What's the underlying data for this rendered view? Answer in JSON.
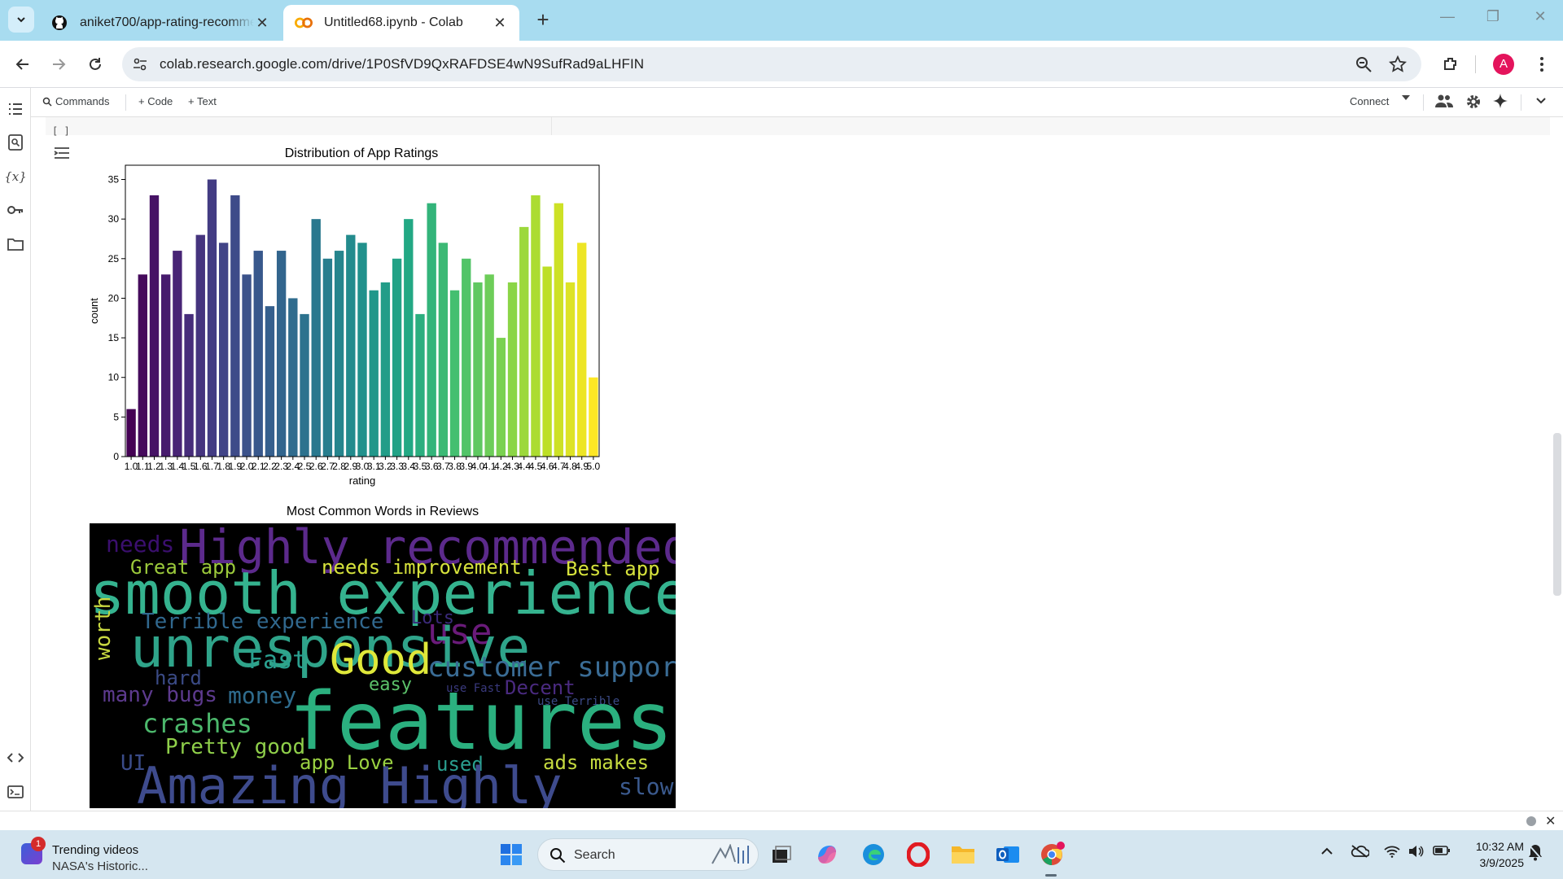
{
  "browser": {
    "tabs": [
      {
        "title": "aniket700/app-rating-recomme",
        "favicon": "github-icon",
        "active": false
      },
      {
        "title": "Untitled68.ipynb - Colab",
        "favicon": "colab-icon",
        "active": true
      }
    ],
    "new_tab": "+",
    "url": "colab.research.google.com/drive/1P0SfVD9QxRAFDSE4wN9SufRad9aLHFIN",
    "profile_initial": "A"
  },
  "colab": {
    "toolbar": {
      "commands": "Commands",
      "code": "+ Code",
      "text": "+ Text",
      "connect": "Connect"
    },
    "cell_run": "[ ]"
  },
  "chart_data": [
    {
      "type": "bar",
      "title": "Distribution of App Ratings",
      "xlabel": "rating",
      "ylabel": "count",
      "categories": [
        "1.0",
        "1.1",
        "1.2",
        "1.3",
        "1.4",
        "1.5",
        "1.6",
        "1.7",
        "1.8",
        "1.9",
        "2.0",
        "2.1",
        "2.2",
        "2.3",
        "2.4",
        "2.5",
        "2.6",
        "2.7",
        "2.8",
        "2.9",
        "3.0",
        "3.1",
        "3.2",
        "3.3",
        "3.4",
        "3.5",
        "3.6",
        "3.7",
        "3.8",
        "3.9",
        "4.0",
        "4.1",
        "4.2",
        "4.3",
        "4.4",
        "4.5",
        "4.6",
        "4.7",
        "4.8",
        "4.9",
        "5.0"
      ],
      "values": [
        6,
        23,
        33,
        23,
        26,
        18,
        28,
        35,
        27,
        33,
        23,
        26,
        19,
        26,
        20,
        18,
        30,
        25,
        26,
        28,
        27,
        21,
        22,
        25,
        30,
        18,
        32,
        27,
        21,
        25,
        22,
        23,
        15,
        22,
        29,
        33,
        24,
        32,
        22,
        27,
        10
      ],
      "yticks": [
        0,
        5,
        10,
        15,
        20,
        25,
        30,
        35
      ],
      "ylim": [
        0,
        36.8
      ],
      "palette": "viridis",
      "grid": false,
      "legend": "none"
    },
    {
      "type": "wordcloud",
      "title": "Most Common Words in Reviews",
      "words": [
        {
          "text": "needs",
          "color": "#3b0f6f"
        },
        {
          "text": "Highly recommended",
          "color": "#5c2a8c"
        },
        {
          "text": "Great app",
          "color": "#9bc93b"
        },
        {
          "text": "needs improvement",
          "color": "#d6e23c"
        },
        {
          "text": "Best app",
          "color": "#d6e23c"
        },
        {
          "text": "smooth experience",
          "color": "#35b38f"
        },
        {
          "text": "worth",
          "color": "#c9d941"
        },
        {
          "text": "Terrible experience",
          "color": "#31688e"
        },
        {
          "text": "Lots",
          "color": "#3b2a7a"
        },
        {
          "text": "use",
          "color": "#6a1b7a"
        },
        {
          "text": "unresponsive",
          "color": "#2fa48a"
        },
        {
          "text": "Fast",
          "color": "#2a9f8f"
        },
        {
          "text": "Good",
          "color": "#dfe83a"
        },
        {
          "text": "customer support",
          "color": "#3a6c95"
        },
        {
          "text": "hard",
          "color": "#3b4b86"
        },
        {
          "text": "easy",
          "color": "#5cc16a"
        },
        {
          "text": "many bugs",
          "color": "#5d3a8e"
        },
        {
          "text": "money",
          "color": "#2f6c8e"
        },
        {
          "text": "use Fast",
          "color": "#3a3a7e"
        },
        {
          "text": "Decent",
          "color": "#4a2a80"
        },
        {
          "text": "use Terrible",
          "color": "#3b4a86"
        },
        {
          "text": "crashes",
          "color": "#4cb86c"
        },
        {
          "text": "features",
          "color": "#2bb07f"
        },
        {
          "text": "Pretty good",
          "color": "#8fcf4a"
        },
        {
          "text": "UI",
          "color": "#3a4b88"
        },
        {
          "text": "app Love",
          "color": "#9ad142"
        },
        {
          "text": "used",
          "color": "#2a9f8f"
        },
        {
          "text": "ads makes",
          "color": "#c6db3f"
        },
        {
          "text": "Amazing Highly",
          "color": "#3e4b8d"
        },
        {
          "text": "slow",
          "color": "#3b5a8e"
        }
      ]
    }
  ],
  "taskbar": {
    "news_title": "Trending videos",
    "news_sub": "NASA's Historic...",
    "news_badge": "1",
    "search": "Search",
    "time": "10:32 AM",
    "date": "3/9/2025"
  }
}
